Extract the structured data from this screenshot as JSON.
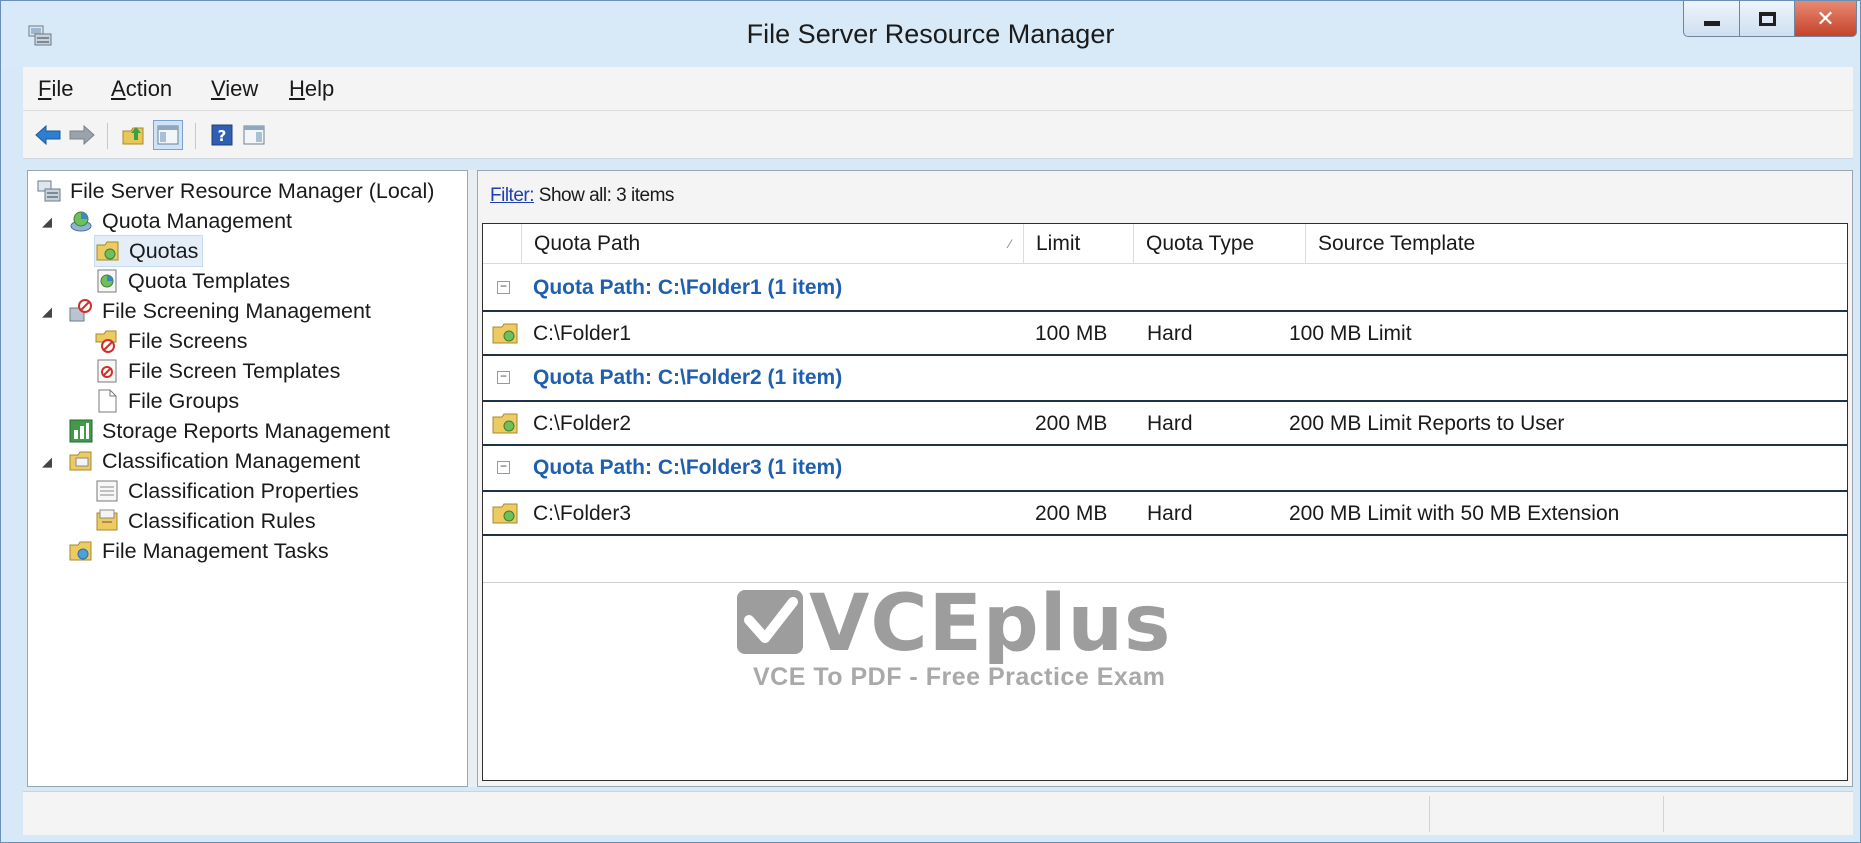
{
  "window": {
    "title": "File Server Resource Manager",
    "app_icon": "server-manager-icon"
  },
  "menu": {
    "items": [
      {
        "first": "F",
        "rest": "ile"
      },
      {
        "first": "A",
        "rest": "ction"
      },
      {
        "first": "V",
        "rest": "iew"
      },
      {
        "first": "H",
        "rest": "elp"
      }
    ]
  },
  "toolbar": {
    "buttons": [
      "back-arrow-icon",
      "forward-arrow-icon",
      "up-folder-icon",
      "show-hide-console-tree-icon",
      "help-icon",
      "action-pane-icon"
    ]
  },
  "tree": {
    "root": "File Server Resource Manager (Local)",
    "quota_management": "Quota Management",
    "quotas": "Quotas",
    "quota_templates": "Quota Templates",
    "file_screening_management": "File Screening Management",
    "file_screens": "File Screens",
    "file_screen_templates": "File Screen Templates",
    "file_groups": "File Groups",
    "storage_reports_management": "Storage Reports Management",
    "classification_management": "Classification Management",
    "classification_properties": "Classification Properties",
    "classification_rules": "Classification Rules",
    "file_management_tasks": "File Management Tasks",
    "selected": "Quotas"
  },
  "filter": {
    "link": "Filter:",
    "text": "Show all: 3 items"
  },
  "columns": {
    "quota_path": "Quota Path",
    "limit": "Limit",
    "quota_type": "Quota Type",
    "source_template": "Source Template"
  },
  "groups": [
    {
      "label": "Quota Path: C:\\Folder1 (1 item)",
      "row": {
        "path": "C:\\Folder1",
        "limit": "100 MB",
        "type": "Hard",
        "template": "100 MB Limit"
      }
    },
    {
      "label": "Quota Path: C:\\Folder2 (1 item)",
      "row": {
        "path": "C:\\Folder2",
        "limit": "200 MB",
        "type": "Hard",
        "template": "200 MB Limit Reports to User"
      }
    },
    {
      "label": "Quota Path: C:\\Folder3 (1 item)",
      "row": {
        "path": "C:\\Folder3",
        "limit": "200 MB",
        "type": "Hard",
        "template": "200 MB Limit with 50 MB Extension"
      }
    }
  ],
  "watermark": {
    "brand": "VCEplus",
    "tagline": "VCE To PDF - Free Practice Exam"
  },
  "colors": {
    "title_bg": "#d8e9f7",
    "group_label": "#1e5fb0",
    "close_button": "#c4432a",
    "filter_link": "#1f3fae"
  }
}
